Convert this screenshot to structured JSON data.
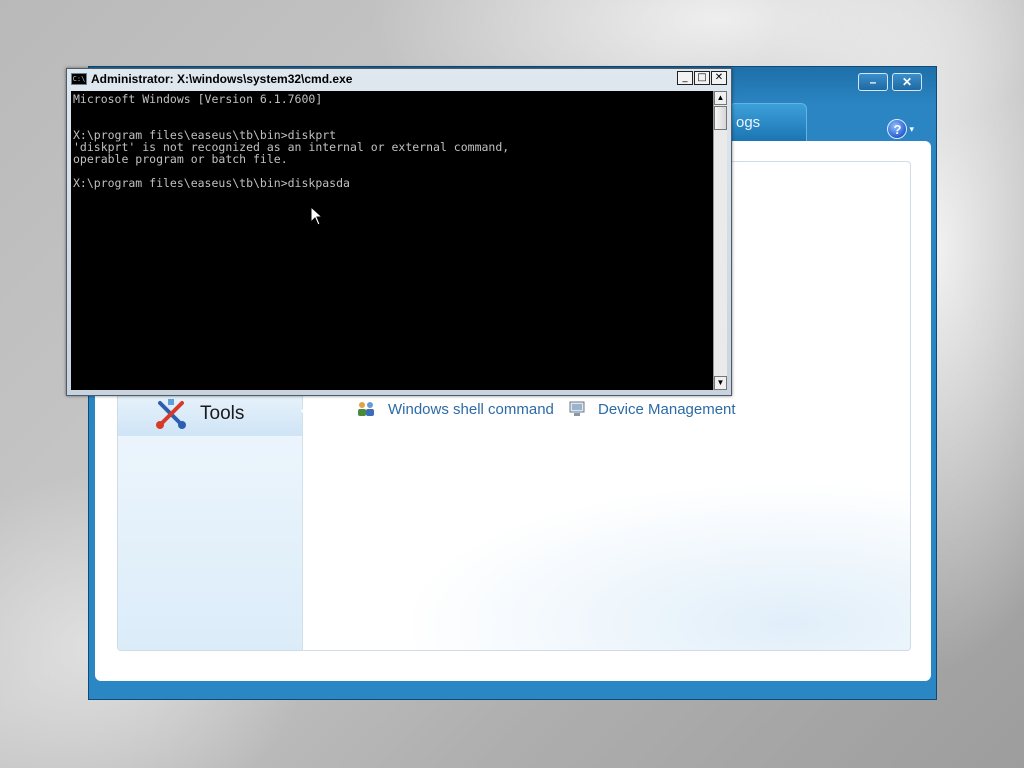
{
  "app": {
    "logs_tab": "ogs",
    "minimize": "–",
    "close": "✕",
    "help": "?",
    "help_caret": "▾",
    "sidebar": {
      "tools_label": "Tools"
    },
    "tools": [
      {
        "label": "Windows shell command",
        "icon": "users-icon"
      },
      {
        "label": "Device Management",
        "icon": "monitor-icon"
      }
    ]
  },
  "cmd": {
    "title": "Administrator: X:\\windows\\system32\\cmd.exe",
    "icon_text": "C:\\",
    "buttons": {
      "minimize": "_",
      "maximize": "□",
      "close": "✕"
    },
    "lines": [
      "Microsoft Windows [Version 6.1.7600]",
      "",
      "",
      "X:\\program files\\easeus\\tb\\bin>diskprt",
      "'diskprt' is not recognized as an internal or external command,",
      "operable program or batch file.",
      "",
      "X:\\program files\\easeus\\tb\\bin>diskpasda"
    ],
    "scroll_up": "▲",
    "scroll_down": "▼"
  },
  "colors": {
    "app_frame": "#2b86c4",
    "link": "#2d6aa6",
    "console_bg": "#000000",
    "console_text": "#c0c0c0"
  }
}
